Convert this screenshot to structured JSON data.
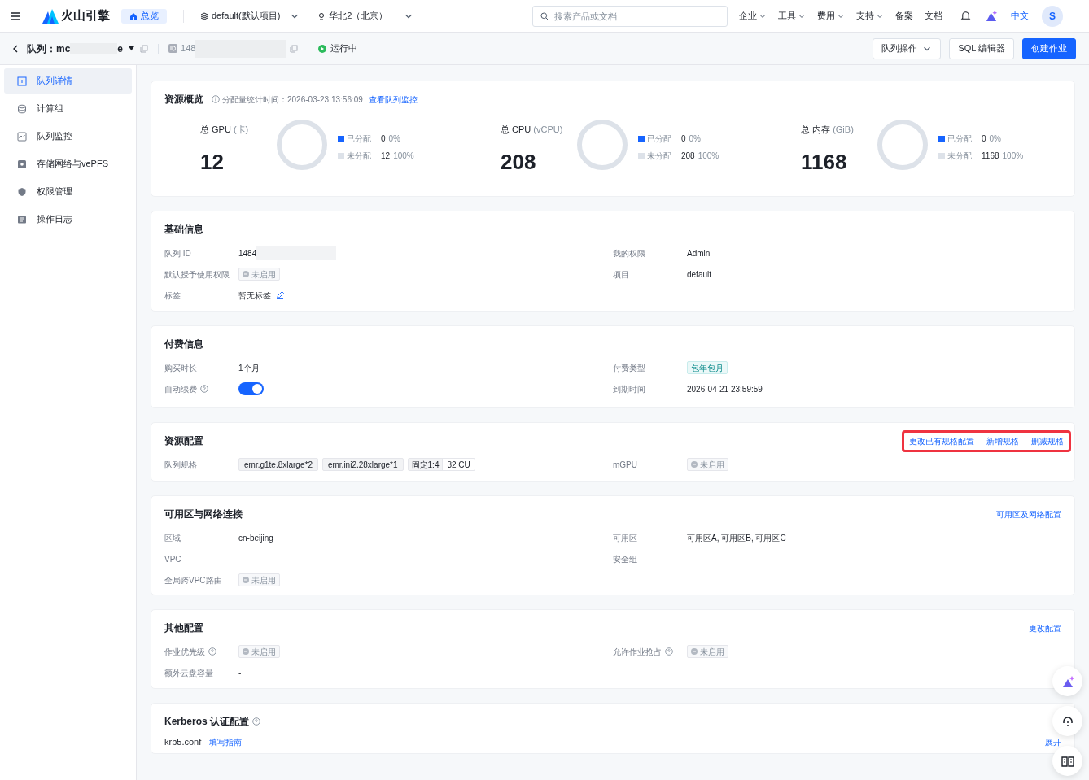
{
  "topbar": {
    "logo": "火山引擎",
    "home_tab": "总览",
    "project": "default(默认项目)",
    "region": "华北2（北京）",
    "search": {
      "placeholder": "搜索产品或文档"
    },
    "nav": [
      {
        "label": "企业",
        "dropdown": true
      },
      {
        "label": "工具",
        "dropdown": true
      },
      {
        "label": "费用",
        "dropdown": true
      },
      {
        "label": "支持",
        "dropdown": true
      },
      {
        "label": "备案",
        "dropdown": false
      },
      {
        "label": "文档",
        "dropdown": false
      }
    ],
    "language": {
      "label": "中文",
      "selected": true
    },
    "avatar": "S"
  },
  "header": {
    "title_start": "队列：mc",
    "title_end": "e",
    "id_start": "148",
    "status": "运行中",
    "buttons": [
      {
        "label": "队列操作",
        "kind": "menu"
      },
      {
        "label": "SQL 编辑器",
        "kind": "default"
      },
      {
        "label": "创建作业",
        "kind": "primary"
      }
    ]
  },
  "sidebar": {
    "items": [
      {
        "label": "队列详情",
        "selected": true
      },
      {
        "label": "计算组",
        "selected": false
      },
      {
        "label": "队列监控",
        "selected": false
      },
      {
        "label": "存储网络与vePFS",
        "selected": false
      },
      {
        "label": "权限管理",
        "selected": false
      },
      {
        "label": "操作日志",
        "selected": false
      }
    ]
  },
  "overview": {
    "title": "资源概览",
    "stat_time": "分配量统计时间：2026-03-23 13:56:09",
    "link": "查看队列监控",
    "stats": [
      {
        "label": "总 GPU",
        "unit": "(卡)",
        "total": "12",
        "legend": [
          {
            "label": "已分配",
            "value": "0",
            "pct": "0%",
            "color": "#1664ff"
          },
          {
            "label": "未分配",
            "value": "12",
            "pct": "100%",
            "color": "#dde2e9"
          }
        ]
      },
      {
        "label": "总 CPU",
        "unit": "(vCPU)",
        "total": "208",
        "legend": [
          {
            "label": "已分配",
            "value": "0",
            "pct": "0%",
            "color": "#1664ff"
          },
          {
            "label": "未分配",
            "value": "208",
            "pct": "100%",
            "color": "#dde2e9"
          }
        ]
      },
      {
        "label": "总 内存",
        "unit": "(GiB)",
        "total": "1168",
        "legend": [
          {
            "label": "已分配",
            "value": "0",
            "pct": "0%",
            "color": "#1664ff"
          },
          {
            "label": "未分配",
            "value": "1168",
            "pct": "100%",
            "color": "#dde2e9"
          }
        ]
      }
    ]
  },
  "sections": [
    {
      "title": "基础信息",
      "rows": [
        [
          {
            "label": "队列 ID",
            "kind": "masked",
            "value": "1484"
          },
          {
            "label": "我的权限",
            "kind": "text",
            "value": "Admin"
          }
        ],
        [
          {
            "label": "默认授予使用权限",
            "kind": "status",
            "value": "未启用"
          },
          {
            "label": "项目",
            "kind": "text",
            "value": "default"
          }
        ],
        [
          {
            "label": "标签",
            "kind": "editable",
            "value": "暂无标签"
          }
        ]
      ]
    },
    {
      "title": "付费信息",
      "rows": [
        [
          {
            "label": "购买时长",
            "kind": "text",
            "value": "1个月"
          },
          {
            "label": "付费类型",
            "kind": "badge",
            "value": "包年包月"
          }
        ],
        [
          {
            "label": "自动续费",
            "help": true,
            "kind": "toggle",
            "on": true
          },
          {
            "label": "到期时间",
            "kind": "text",
            "value": "2026-04-21 23:59:59"
          }
        ]
      ]
    },
    {
      "title": "资源配置",
      "actions": [
        "更改已有规格配置",
        "新增规格",
        "删减规格"
      ],
      "highlight": true,
      "rows": [
        [
          {
            "label": "队列规格",
            "kind": "specs",
            "specs": [
              {
                "kind": "chip",
                "text": "emr.g1te.8xlarge*2"
              },
              {
                "kind": "chip",
                "text": "emr.ini2.28xlarge*1"
              },
              {
                "kind": "ratio",
                "text": "固定1:4",
                "amount": "32 CU"
              }
            ]
          },
          {
            "label": "mGPU",
            "kind": "status",
            "value": "未启用"
          }
        ]
      ]
    },
    {
      "title": "可用区与网络连接",
      "actions": [
        "可用区及网络配置"
      ],
      "rows": [
        [
          {
            "label": "区域",
            "kind": "text",
            "value": "cn-beijing"
          },
          {
            "label": "可用区",
            "kind": "text",
            "value": "可用区A, 可用区B, 可用区C"
          }
        ],
        [
          {
            "label": "VPC",
            "kind": "text",
            "value": "-"
          },
          {
            "label": "安全组",
            "kind": "text",
            "value": "-"
          }
        ],
        [
          {
            "label": "全局跨VPC路由",
            "kind": "status",
            "value": "未启用"
          }
        ]
      ]
    },
    {
      "title": "其他配置",
      "actions": [
        "更改配置"
      ],
      "rows": [
        [
          {
            "label": "作业优先级",
            "help": true,
            "kind": "status",
            "value": "未启用"
          },
          {
            "label": "允许作业抢占",
            "help": true,
            "kind": "status",
            "value": "未启用"
          }
        ],
        [
          {
            "label": "额外云盘容量",
            "kind": "text",
            "value": "-"
          }
        ]
      ]
    }
  ],
  "kerberos": {
    "title": "Kerberos 认证配置",
    "file": "krb5.conf",
    "guide": "填写指南",
    "expand": "展开"
  }
}
